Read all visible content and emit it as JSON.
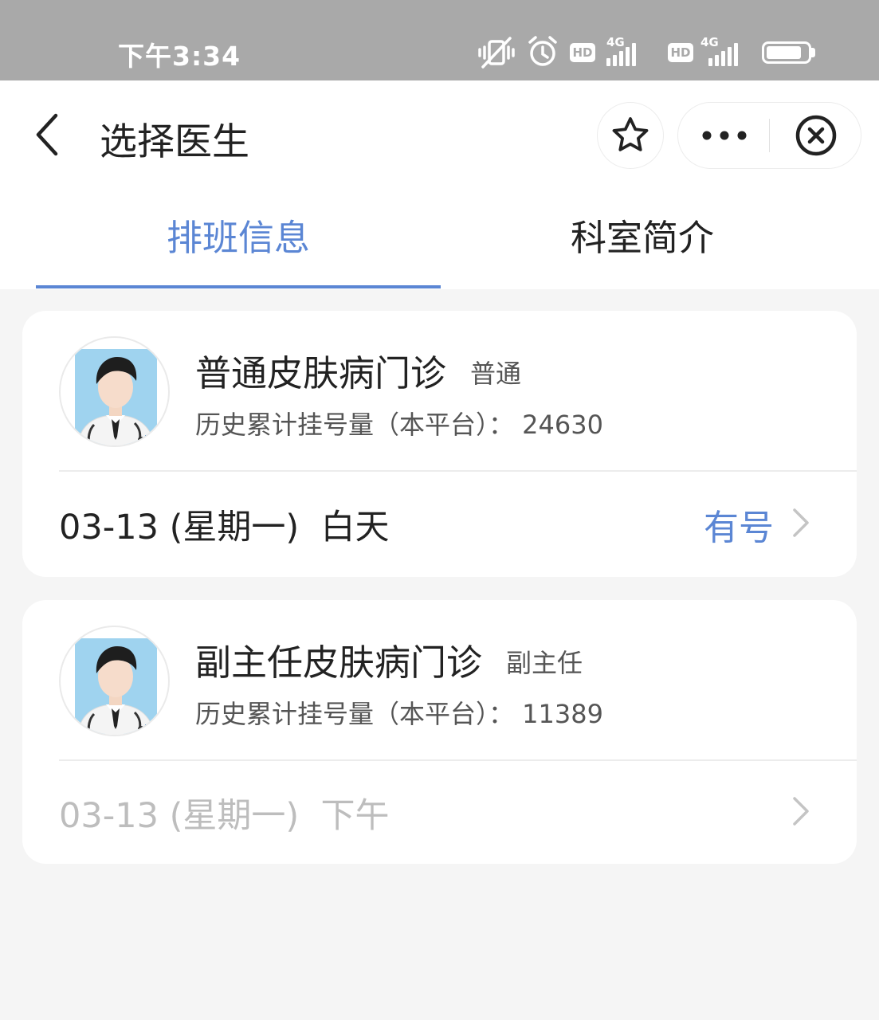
{
  "status_bar": {
    "time": "下午3:34",
    "network_1": "4G",
    "network_2": "4G",
    "hd_label": "HD",
    "battery_level": 0.85
  },
  "nav": {
    "title": "选择医生"
  },
  "tabs": [
    {
      "label": "排班信息",
      "active": true
    },
    {
      "label": "科室简介",
      "active": false
    }
  ],
  "clinics": [
    {
      "name": "普通皮肤病门诊",
      "level": "普通",
      "stats": "历史累计挂号量（本平台）： 24630",
      "schedule": "03-13 (星期一)  白天",
      "availability": "有号",
      "available": true
    },
    {
      "name": "副主任皮肤病门诊",
      "level": "副主任",
      "stats": "历史累计挂号量（本平台）： 11389",
      "schedule": "03-13 (星期一)  下午",
      "availability": "",
      "available": false
    }
  ],
  "colors": {
    "accent": "#5b86d4",
    "status_bar": "#a9a9a9",
    "page_bg": "#f5f5f5",
    "disabled_text": "#bdbdbd"
  },
  "icons": {
    "back": "chevron-left-icon",
    "favorite": "star-icon",
    "more": "more-dots-icon",
    "close": "close-circle-icon",
    "row_arrow": "chevron-right-icon",
    "avatar": "doctor-avatar-icon"
  }
}
